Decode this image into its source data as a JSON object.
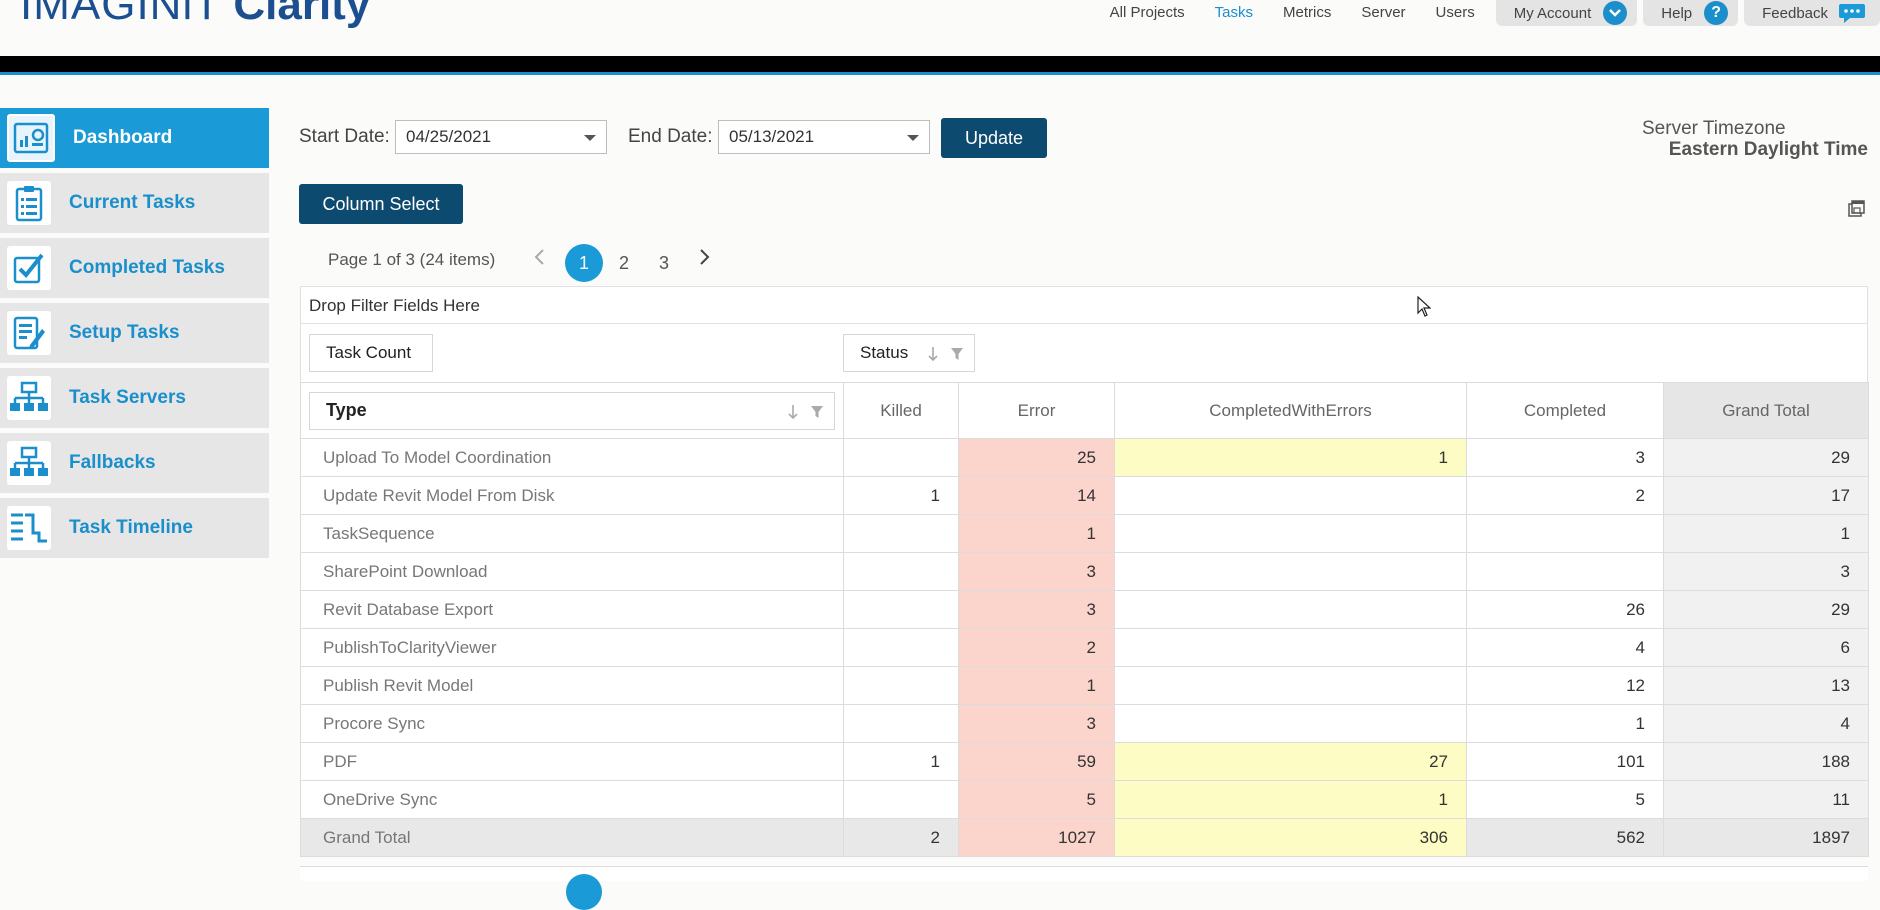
{
  "app": {
    "logo_light": "IMAGINiT",
    "logo_bold": "Clarity"
  },
  "topnav": {
    "links": [
      {
        "label": "All Projects",
        "active": false
      },
      {
        "label": "Tasks",
        "active": true
      },
      {
        "label": "Metrics",
        "active": false
      },
      {
        "label": "Server",
        "active": false
      },
      {
        "label": "Users",
        "active": false
      }
    ],
    "my_account": "My Account",
    "help": "Help",
    "feedback": "Feedback"
  },
  "sidebar": {
    "items": [
      {
        "label": "Dashboard",
        "icon": "dashboard-icon",
        "active": true
      },
      {
        "label": "Current Tasks",
        "icon": "clipboard-icon",
        "active": false
      },
      {
        "label": "Completed Tasks",
        "icon": "checkbox-icon",
        "active": false
      },
      {
        "label": "Setup Tasks",
        "icon": "edit-list-icon",
        "active": false
      },
      {
        "label": "Task Servers",
        "icon": "network-icon",
        "active": false
      },
      {
        "label": "Fallbacks",
        "icon": "network-icon",
        "active": false
      },
      {
        "label": "Task Timeline",
        "icon": "timeline-icon",
        "active": false
      }
    ]
  },
  "filters": {
    "start_label": "Start Date:",
    "start_value": "04/25/2021",
    "end_label": "End Date:",
    "end_value": "05/13/2021",
    "update_button": "Update",
    "column_select_button": "Column Select"
  },
  "timezone": {
    "label": "Server Timezone",
    "value": "Eastern Daylight Time"
  },
  "pager": {
    "info": "Page 1 of 3 (24 items)",
    "pages": [
      "1",
      "2",
      "3"
    ],
    "current": "1"
  },
  "pivot": {
    "filter_area": "Drop Filter Fields Here",
    "data_field": "Task Count",
    "column_field": "Status",
    "row_field": "Type",
    "columns": [
      "Killed",
      "Error",
      "CompletedWithErrors",
      "Completed",
      "Grand Total"
    ],
    "rows": [
      {
        "type": "Upload To Model Coordination",
        "killed": "",
        "error": "25",
        "cwe": "1",
        "completed": "3",
        "total": "29"
      },
      {
        "type": "Update Revit Model From Disk",
        "killed": "1",
        "error": "14",
        "cwe": "",
        "completed": "2",
        "total": "17"
      },
      {
        "type": "TaskSequence",
        "killed": "",
        "error": "1",
        "cwe": "",
        "completed": "",
        "total": "1"
      },
      {
        "type": "SharePoint Download",
        "killed": "",
        "error": "3",
        "cwe": "",
        "completed": "",
        "total": "3"
      },
      {
        "type": "Revit Database Export",
        "killed": "",
        "error": "3",
        "cwe": "",
        "completed": "26",
        "total": "29"
      },
      {
        "type": "PublishToClarityViewer",
        "killed": "",
        "error": "2",
        "cwe": "",
        "completed": "4",
        "total": "6"
      },
      {
        "type": "Publish Revit Model",
        "killed": "",
        "error": "1",
        "cwe": "",
        "completed": "12",
        "total": "13"
      },
      {
        "type": "Procore Sync",
        "killed": "",
        "error": "3",
        "cwe": "",
        "completed": "1",
        "total": "4"
      },
      {
        "type": "PDF",
        "killed": "1",
        "error": "59",
        "cwe": "27",
        "completed": "101",
        "total": "188"
      },
      {
        "type": "OneDrive Sync",
        "killed": "",
        "error": "5",
        "cwe": "1",
        "completed": "5",
        "total": "11"
      }
    ],
    "grand_total": {
      "type": "Grand Total",
      "killed": "2",
      "error": "1027",
      "cwe": "306",
      "completed": "562",
      "total": "1897"
    }
  },
  "colors": {
    "accent": "#1a9ad6",
    "dark_button": "#0d4a6f",
    "error_cell": "#fbd5cc",
    "warning_cell": "#fdfcc4"
  }
}
